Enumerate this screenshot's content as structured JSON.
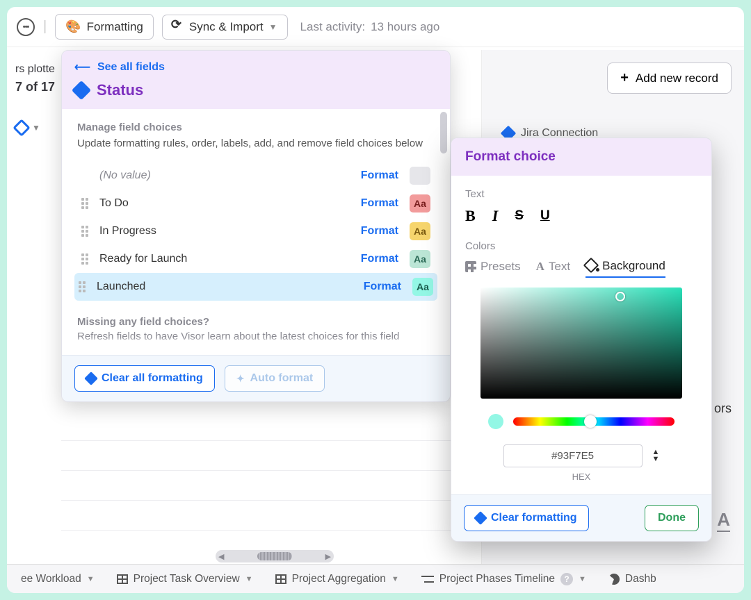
{
  "toolbar": {
    "formatting_label": "Formatting",
    "sync_label": "Sync & Import",
    "last_activity_label": "Last activity:",
    "last_activity_value": "13 hours ago"
  },
  "left_fragment": {
    "line1": "rs plotte",
    "count": "7 of 17"
  },
  "right_panel": {
    "add_record": "Add new record",
    "jira": "Jira Connection",
    "ors": "ors"
  },
  "status_panel": {
    "see_all": "See all fields",
    "title": "Status",
    "manage_heading": "Manage field choices",
    "manage_desc": "Update formatting rules, order, labels, add, and remove field choices below",
    "no_value": "(No value)",
    "choices": [
      {
        "label": "To Do",
        "swatch": "sw-red",
        "txt": "Aa"
      },
      {
        "label": "In Progress",
        "swatch": "sw-yel",
        "txt": "Aa"
      },
      {
        "label": "Ready for Launch",
        "swatch": "sw-grn",
        "txt": "Aa"
      },
      {
        "label": "Launched",
        "swatch": "sw-mint",
        "txt": "Aa"
      }
    ],
    "format_link": "Format",
    "missing_heading": "Missing any field choices?",
    "missing_desc": "Refresh fields to have Visor learn about the latest choices for this field",
    "clear_all": "Clear all formatting",
    "auto_format": "Auto format"
  },
  "format_choice": {
    "title": "Format choice",
    "text_label": "Text",
    "colors_label": "Colors",
    "tab_presets": "Presets",
    "tab_text": "Text",
    "tab_background": "Background",
    "hex_value": "#93F7E5",
    "hex_label": "HEX",
    "clear": "Clear formatting",
    "done": "Done",
    "B": "B",
    "I": "I",
    "S": "S",
    "U": "U"
  },
  "tabs": {
    "t0": "ee Workload",
    "t1": "Project Task Overview",
    "t2": "Project Aggregation",
    "t3": "Project Phases Timeline",
    "t4": "Dashb"
  }
}
